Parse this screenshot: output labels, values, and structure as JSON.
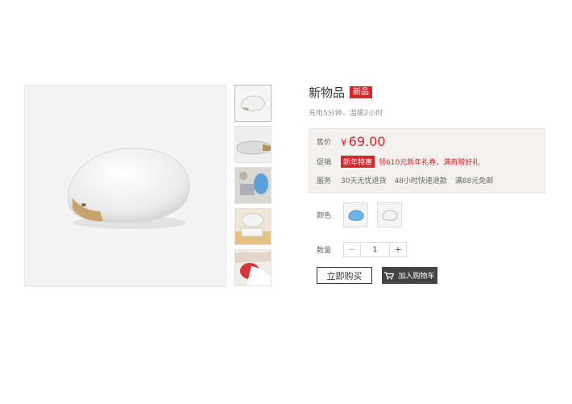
{
  "product": {
    "title": "新物品",
    "badge": "新品",
    "subtitle": "充电5分钟，温暖2小时"
  },
  "price_box": {
    "price_label": "售价",
    "currency": "¥",
    "price": "69.00",
    "promo_label": "促销",
    "promo_tag": "新年特惠",
    "promo_text": "领610元新年礼券，满再赠好礼",
    "service_label": "服务",
    "services": [
      "30天无忧退货",
      "48小时快速退款",
      "满88元免邮"
    ]
  },
  "options": {
    "color_label": "颜色",
    "colors": [
      "blue",
      "white"
    ],
    "quantity_label": "数量",
    "quantity_value": "1",
    "minus": "−",
    "plus": "+"
  },
  "actions": {
    "buy_now": "立即购买",
    "add_to_cart": "加入购物车"
  },
  "colors": {
    "accent": "#d4282d",
    "panel_bg": "#f3f2ee",
    "cart_btn": "#444444"
  }
}
